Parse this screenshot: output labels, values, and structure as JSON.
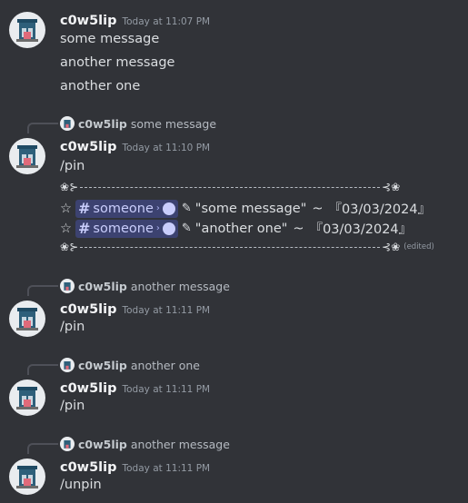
{
  "user": {
    "name": "c0w5lip"
  },
  "icons": {
    "star": "☆",
    "flower": "❀",
    "hook": "⊱",
    "hook_right": "⊰",
    "pencil": "✎",
    "hash": "#",
    "chevron": "›",
    "thread": "thread-bubble-icon"
  },
  "messages": [
    {
      "timestamp": "Today at 11:07 PM",
      "lines": [
        "some message",
        "another message",
        "another one"
      ]
    },
    {
      "reply": {
        "name": "c0w5lip",
        "text": "some message"
      },
      "timestamp": "Today at 11:10 PM",
      "lines": [
        "/pin"
      ],
      "pins": [
        {
          "channel": "someone",
          "text": "\"some message\"",
          "tilde": "~",
          "date": "『03/03/2024』"
        },
        {
          "channel": "someone",
          "text": "\"another one\"",
          "tilde": "~",
          "date": "『03/03/2024』"
        }
      ],
      "edited": "(edited)"
    },
    {
      "reply": {
        "name": "c0w5lip",
        "text": "another message"
      },
      "timestamp": "Today at 11:11 PM",
      "lines": [
        "/pin"
      ]
    },
    {
      "reply": {
        "name": "c0w5lip",
        "text": "another one"
      },
      "timestamp": "Today at 11:11 PM",
      "lines": [
        "/pin"
      ]
    },
    {
      "reply": {
        "name": "c0w5lip",
        "text": "another message"
      },
      "timestamp": "Today at 11:11 PM",
      "lines": [
        "/unpin"
      ]
    }
  ]
}
